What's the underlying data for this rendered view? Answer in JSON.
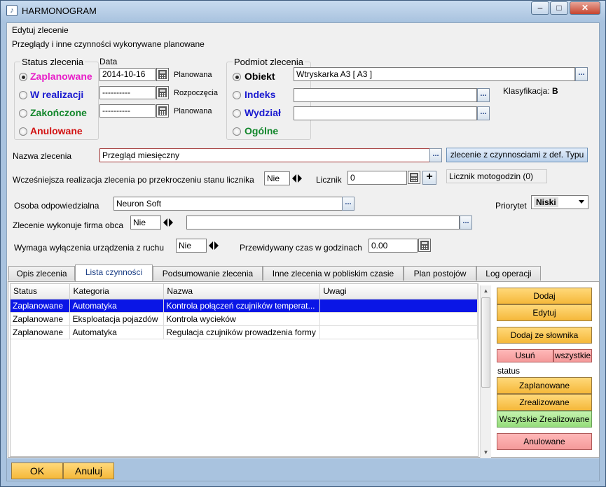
{
  "window": {
    "title": "HARMONOGRAM",
    "minimize": "–",
    "maximize": "□",
    "close": "✕"
  },
  "header": {
    "line1": "Edytuj zlecenie",
    "line2": "Przeglądy i inne czynności wykonywane planowane"
  },
  "status": {
    "group_label": "Status zlecenia",
    "options": [
      {
        "label": "Zaplanowane",
        "color": "#e81ec8",
        "selected": true
      },
      {
        "label": "W realizacji",
        "color": "#1a1ad0",
        "selected": false
      },
      {
        "label": "Zakończone",
        "color": "#11862a",
        "selected": false
      },
      {
        "label": "Anulowane",
        "color": "#d21212",
        "selected": false
      }
    ]
  },
  "data": {
    "label": "Data",
    "rows": [
      {
        "value": "2014-10-16",
        "caption": "Planowana"
      },
      {
        "value": "----------",
        "caption": "Rozpoczęcia"
      },
      {
        "value": "----------",
        "caption": "Planowana"
      }
    ]
  },
  "podmiot": {
    "group_label": "Podmiot zlecenia",
    "options": [
      {
        "label": "Obiekt",
        "color": "#000000",
        "selected": true,
        "value": "Wtryskarka A3 [ A3 ]"
      },
      {
        "label": "Indeks",
        "color": "#1a1ad0",
        "selected": false,
        "value": ""
      },
      {
        "label": "Wydział",
        "color": "#1a1ad0",
        "selected": false,
        "value": ""
      },
      {
        "label": "Ogólne",
        "color": "#11862a",
        "selected": false
      }
    ],
    "klasyfikacja_label": "Klasyfikacja:",
    "klasyfikacja_value": "B"
  },
  "nazwa": {
    "label": "Nazwa zlecenia",
    "value": "Przegląd miesięczny",
    "browse": "...",
    "type_button": "zlecenie z czynnosciami z def. Typu"
  },
  "wczesniejsza": {
    "label": "Wcześniejsza realizacja  zlecenia po przekroczeniu stanu licznika",
    "value": "Nie"
  },
  "licznik": {
    "label": "Licznik",
    "value": "0",
    "plus": "+",
    "info": "Licznik motogodzin (0)"
  },
  "osoba": {
    "label": "Osoba odpowiedzialna",
    "value": "Neuron Soft",
    "browse": "..."
  },
  "priorytet": {
    "label": "Priorytet",
    "value": "Niski"
  },
  "firma_obca": {
    "label": "Zlecenie wykonuje firma obca",
    "value": "Nie",
    "company": "",
    "browse": "..."
  },
  "wymaga": {
    "label": "Wymaga wyłączenia urządzenia z ruchu",
    "value": "Nie"
  },
  "czas": {
    "label": "Przewidywany czas w godzinach",
    "value": "0.00"
  },
  "tabs": [
    {
      "label": "Opis zlecenia",
      "active": false
    },
    {
      "label": "Lista czynności",
      "active": true
    },
    {
      "label": "Podsumowanie zlecenia",
      "active": false
    },
    {
      "label": "Inne zlecenia w pobliskim czasie",
      "active": false
    },
    {
      "label": "Plan postojów",
      "active": false
    },
    {
      "label": "Log operacji",
      "active": false
    }
  ],
  "table": {
    "columns": [
      "Status",
      "Kategoria",
      "Nazwa",
      "Uwagi"
    ],
    "rows": [
      {
        "status": "Zaplanowane",
        "kategoria": "Automatyka",
        "nazwa": "Kontrola połączeń czujników temperat...",
        "uwagi": "",
        "selected": true
      },
      {
        "status": "Zaplanowane",
        "kategoria": "Eksploatacja pojazdów",
        "nazwa": "Kontrola wycieków",
        "uwagi": "",
        "selected": false
      },
      {
        "status": "Zaplanowane",
        "kategoria": "Automatyka",
        "nazwa": "Regulacja czujników prowadzenia formy",
        "uwagi": "",
        "selected": false
      }
    ]
  },
  "side": {
    "dodaj": "Dodaj",
    "edytuj": "Edytuj",
    "dodaj_slownik": "Dodaj ze słownika",
    "usun": "Usuń",
    "wszystkie": "wszystkie",
    "status_label": "status",
    "zaplanowane": "Zaplanowane",
    "zrealizowane": "Zrealizowane",
    "wszystkie_zrealizowane": "Wszytskie Zrealizowane",
    "anulowane": "Anulowane"
  },
  "footer": {
    "ok": "OK",
    "cancel": "Anuluj"
  },
  "colors": {
    "accent": "#0a16e6",
    "button": "#f5b83a",
    "frame": "#a9c3df"
  }
}
